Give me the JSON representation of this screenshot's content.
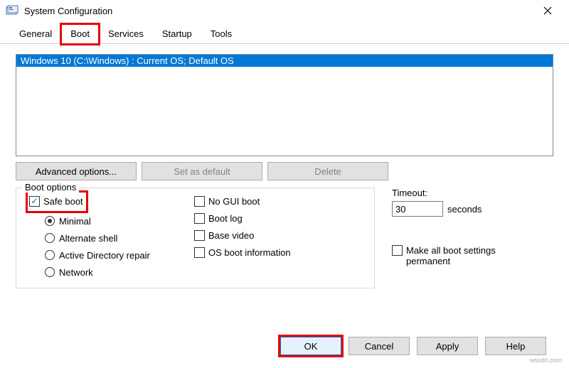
{
  "window": {
    "title": "System Configuration"
  },
  "tabs": {
    "general": "General",
    "boot": "Boot",
    "services": "Services",
    "startup": "Startup",
    "tools": "Tools"
  },
  "boot_list": {
    "item0": "Windows 10 (C:\\Windows) : Current OS; Default OS"
  },
  "buttons": {
    "advanced": "Advanced options...",
    "set_default": "Set as default",
    "delete": "Delete"
  },
  "boot_options": {
    "legend": "Boot options",
    "safe_boot": "Safe boot",
    "minimal": "Minimal",
    "alternate_shell": "Alternate shell",
    "ad_repair": "Active Directory repair",
    "network": "Network",
    "no_gui": "No GUI boot",
    "boot_log": "Boot log",
    "base_video": "Base video",
    "os_boot_info": "OS boot information"
  },
  "timeout": {
    "label": "Timeout:",
    "value": "30",
    "unit": "seconds"
  },
  "make_permanent": "Make all boot settings permanent",
  "footer": {
    "ok": "OK",
    "cancel": "Cancel",
    "apply": "Apply",
    "help": "Help"
  },
  "watermark": "wsxdn.com"
}
